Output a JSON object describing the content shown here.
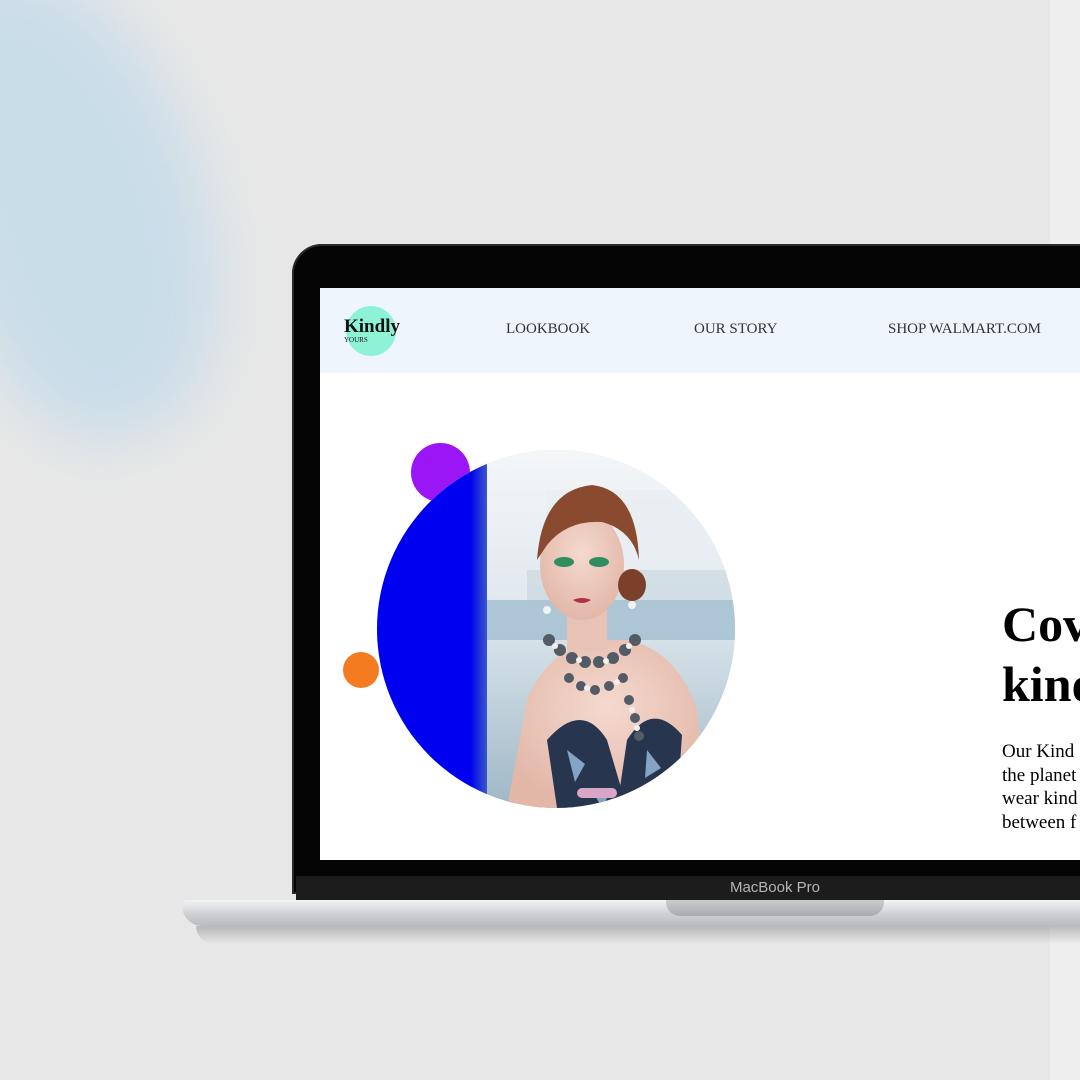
{
  "device": {
    "brand_label": "MacBook Pro"
  },
  "site": {
    "logo": {
      "word": "Kindly",
      "sub": "YOURS",
      "accent_color": "#8ef3d6"
    },
    "nav": {
      "links": [
        {
          "label": "LOOKBOOK"
        },
        {
          "label": "OUR STORY"
        },
        {
          "label": "SHOP WALMART.COM"
        }
      ],
      "background_color": "#eef5fd"
    },
    "hero": {
      "headline_lines": [
        "Cov",
        "kind"
      ],
      "body_lines": [
        "Our Kind",
        "the planet",
        "wear kind",
        "between f"
      ],
      "accent_colors": {
        "purple_dot": "#9a16f6",
        "orange_dot": "#f47b20",
        "blue_panel": "#0000f0"
      }
    }
  }
}
